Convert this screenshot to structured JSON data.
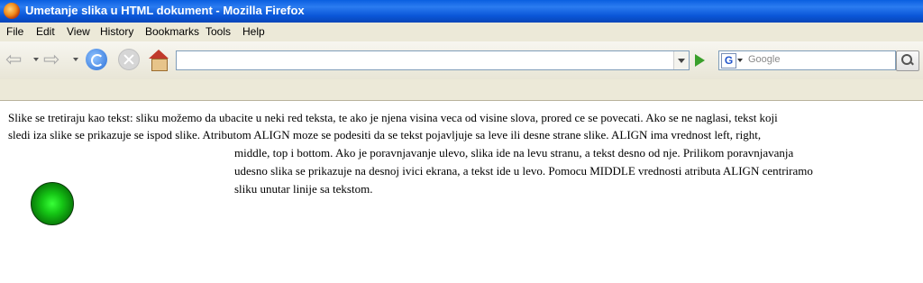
{
  "window": {
    "title": "Umetanje slika u HTML dokument - Mozilla Firefox"
  },
  "menu": {
    "items": [
      "File",
      "Edit",
      "View",
      "History",
      "Bookmarks",
      "Tools",
      "Help"
    ]
  },
  "toolbar": {
    "url_value": "",
    "search_placeholder": "Google",
    "search_engine_letter": "G"
  },
  "content": {
    "lines": [
      "Slike se tretiraju kao tekst: sliku možemo da ubacite u neki red teksta, te ako je njena visina veca od visine slova, prored ce se povecati. Ako se ne naglasi, tekst koji",
      "sledi iza slike se prikazuje se ispod slike. Atributom ALIGN moze se podesiti da se tekst pojavljuje sa leve ili desne strane slike. ALIGN ima vrednost left, right,",
      "middle, top i bottom. Ako je poravnjavanje ulevo, slika ide na levu stranu, a tekst desno od nje. Prilikom poravnjavanja",
      "udesno slika se prikazuje na desnoj ivici ekrana, a tekst ide u levo. Pomocu MIDDLE vrednosti atributa ALIGN centriramo",
      "sliku unutar linije sa tekstom."
    ]
  },
  "colors": {
    "titlebar": "#0a56d8",
    "chrome": "#ece9d8",
    "ball": "#15c515"
  }
}
